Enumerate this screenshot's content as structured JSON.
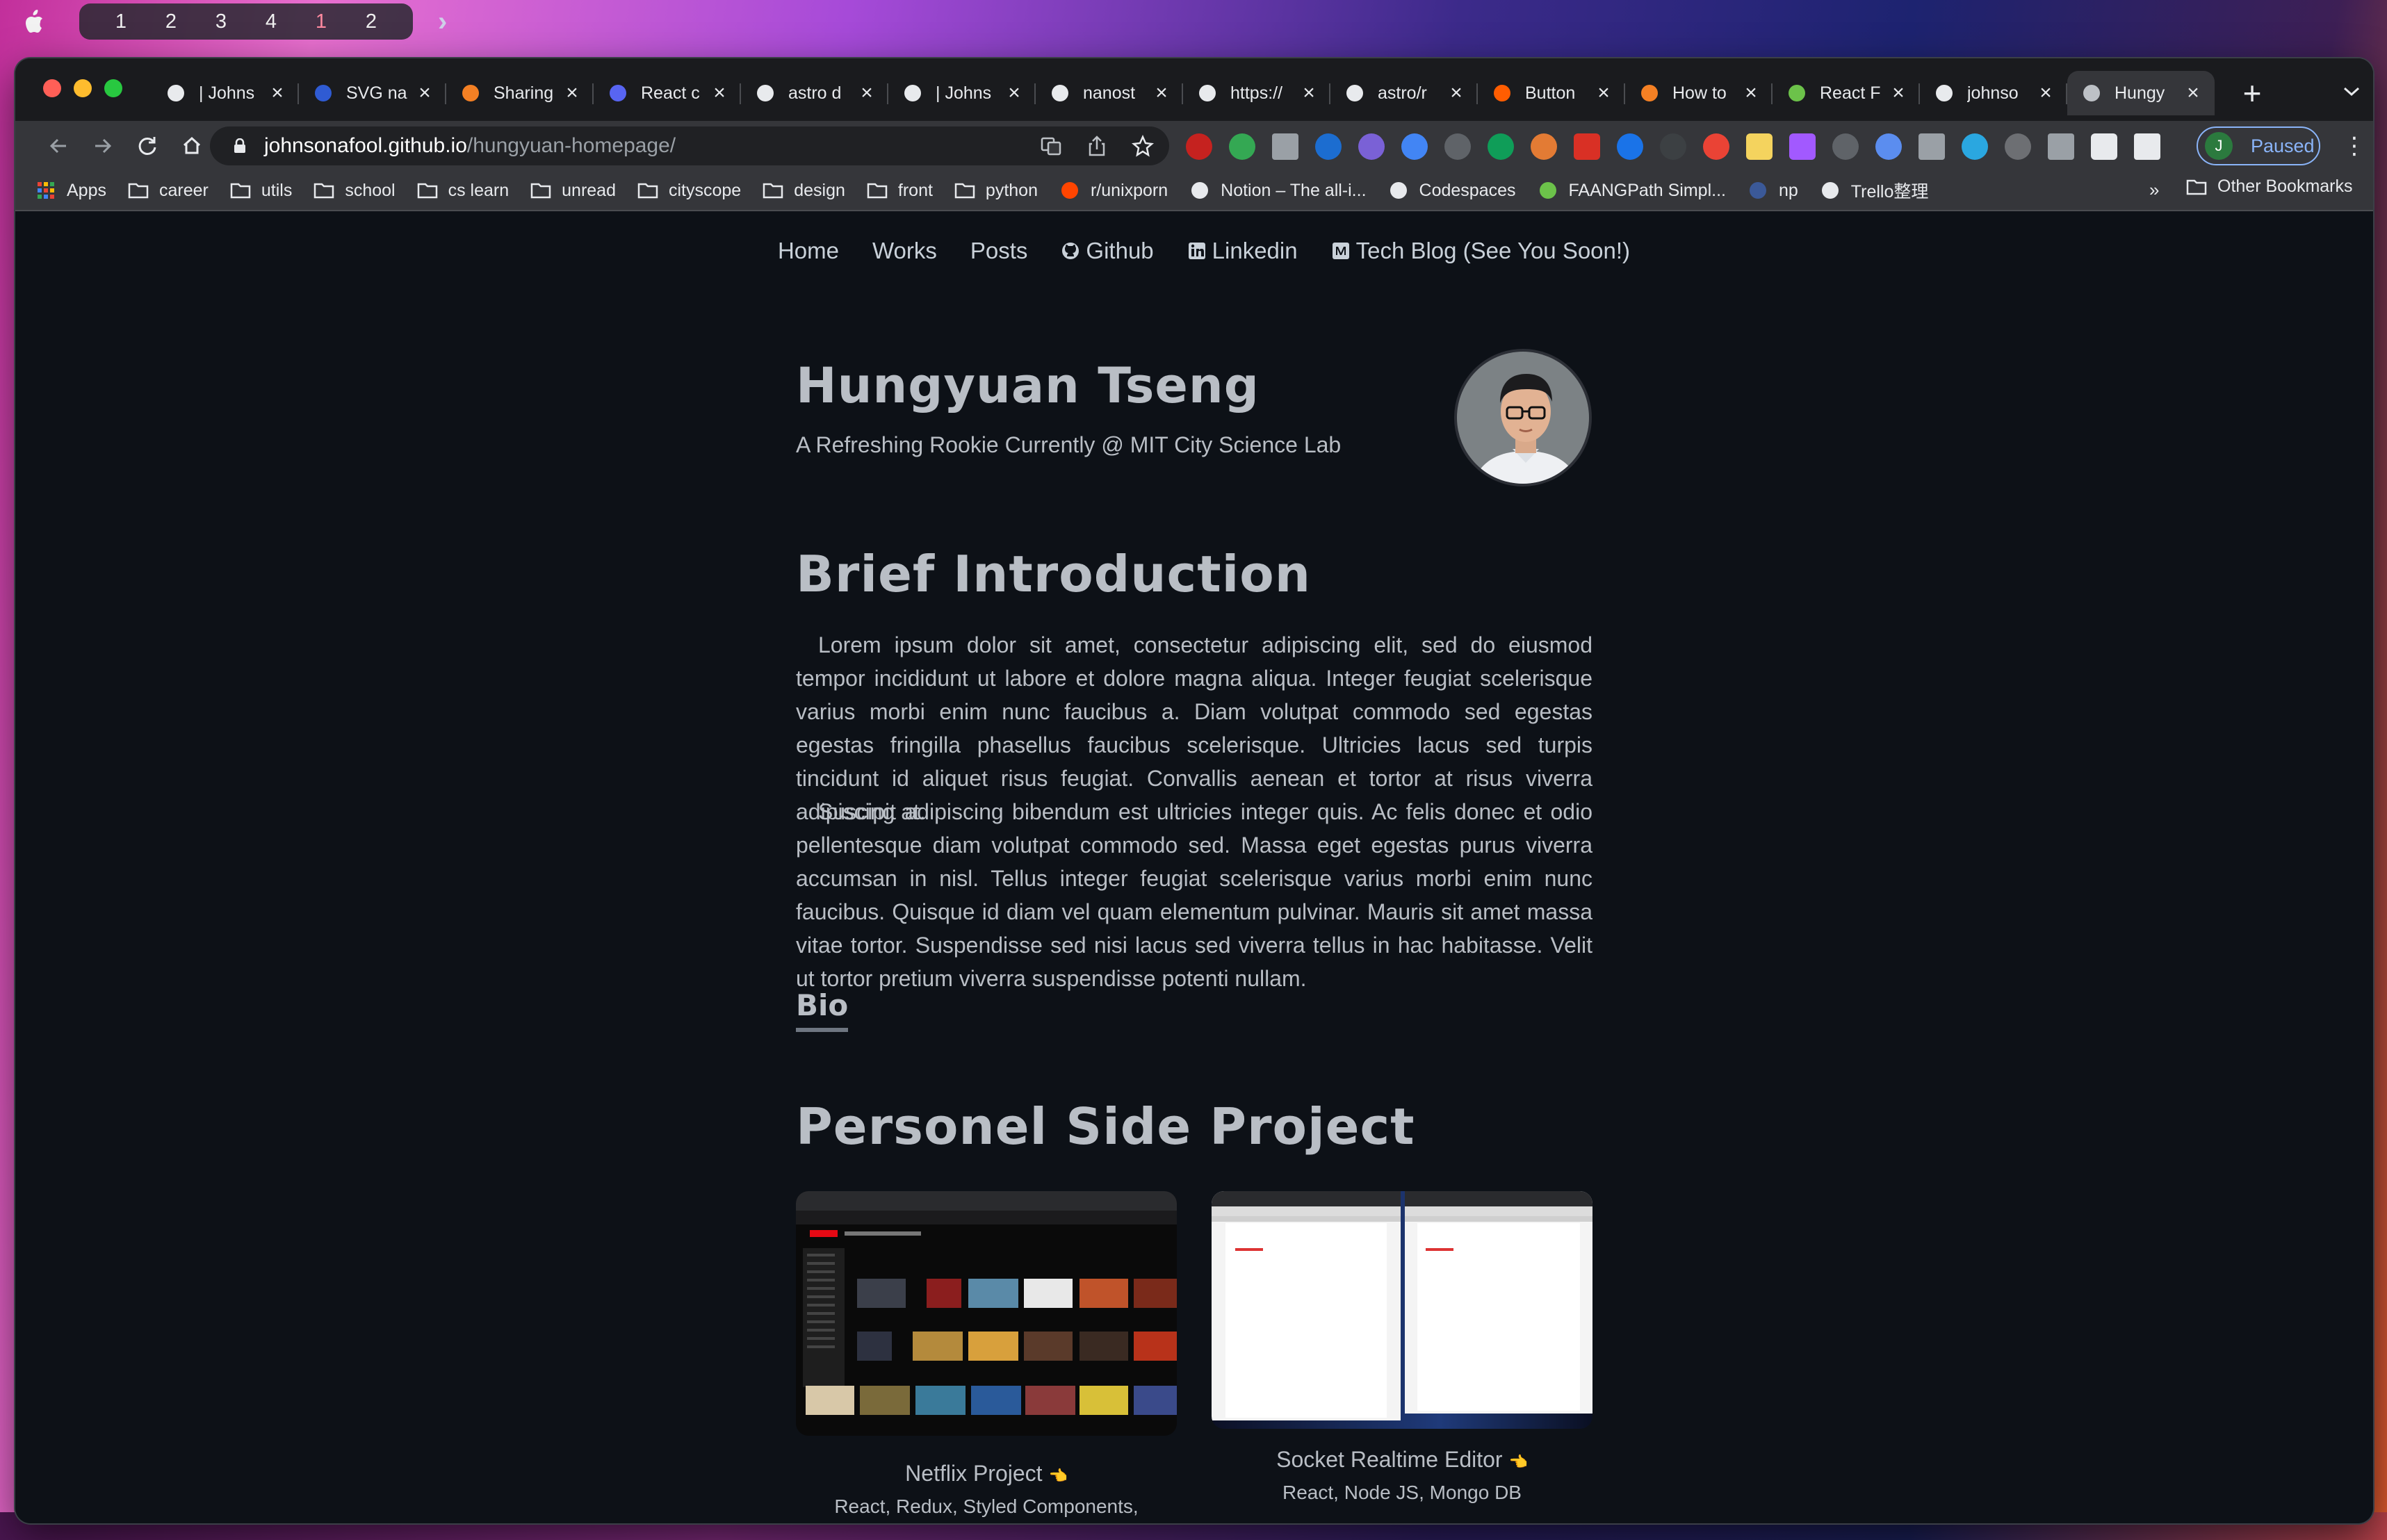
{
  "menubar": {
    "spaces": [
      "1",
      "2",
      "3",
      "4",
      "1",
      "2"
    ],
    "active_space": 4
  },
  "browser": {
    "tabs": [
      {
        "title": "| Johns",
        "icon": "astro-icon"
      },
      {
        "title": "SVG na",
        "icon": "w3-icon"
      },
      {
        "title": "Sharing",
        "icon": "stackoverflow-icon"
      },
      {
        "title": "React c",
        "icon": "mui-icon"
      },
      {
        "title": "astro d",
        "icon": "astro-docs-icon"
      },
      {
        "title": "| Johns",
        "icon": "astro-icon"
      },
      {
        "title": "nanost",
        "icon": "github-icon"
      },
      {
        "title": "https://",
        "icon": "amazon-icon"
      },
      {
        "title": "astro/r",
        "icon": "github-icon"
      },
      {
        "title": "Button",
        "icon": "astro-rocket-icon"
      },
      {
        "title": "How to",
        "icon": "stackoverflow-icon"
      },
      {
        "title": "React F",
        "icon": "react-code-icon"
      },
      {
        "title": "johnso",
        "icon": "github-icon"
      },
      {
        "title": "Hungy",
        "icon": "globe-icon"
      }
    ],
    "url_host": "johnsonafool.github.io",
    "url_path": "/hungyuan-homepage/",
    "profile_initial": "J",
    "profile_status": "Paused",
    "bookmarks": [
      {
        "label": "Apps",
        "icon": "apps-grid-icon"
      },
      {
        "label": "career",
        "icon": "folder-icon"
      },
      {
        "label": "utils",
        "icon": "folder-icon"
      },
      {
        "label": "school",
        "icon": "folder-icon"
      },
      {
        "label": "cs learn",
        "icon": "folder-icon"
      },
      {
        "label": "unread",
        "icon": "folder-icon"
      },
      {
        "label": "cityscope",
        "icon": "folder-icon"
      },
      {
        "label": "design",
        "icon": "folder-icon"
      },
      {
        "label": "front",
        "icon": "folder-icon"
      },
      {
        "label": "python",
        "icon": "folder-icon"
      },
      {
        "label": "r/unixporn",
        "icon": "reddit-icon"
      },
      {
        "label": "Notion – The all-i...",
        "icon": "notion-icon"
      },
      {
        "label": "Codespaces",
        "icon": "github-icon"
      },
      {
        "label": "FAANGPath Simpl...",
        "icon": "faangpath-icon"
      },
      {
        "label": "np",
        "icon": "np-icon"
      },
      {
        "label": "Trello整理",
        "icon": "trello-icon"
      }
    ],
    "bookmarks_overflow": "»",
    "other_bookmarks": "Other Bookmarks"
  },
  "site": {
    "nav": [
      {
        "label": "Home",
        "icon": ""
      },
      {
        "label": "Works",
        "icon": ""
      },
      {
        "label": "Posts",
        "icon": ""
      },
      {
        "label": "Github",
        "icon": "github-icon"
      },
      {
        "label": "Linkedin",
        "icon": "linkedin-icon"
      },
      {
        "label": "Tech Blog (See You Soon!)",
        "icon": "medium-icon"
      }
    ],
    "name": "Hungyuan Tseng",
    "tagline": "A Refreshing Rookie Currently @ MIT City Science Lab",
    "intro_heading": "Brief Introduction",
    "intro_p1": "Lorem ipsum dolor sit amet, consectetur adipiscing elit, sed do eiusmod tempor incididunt ut labore et dolore magna aliqua. Integer feugiat scelerisque varius morbi enim nunc faucibus a. Diam volutpat commodo sed egestas egestas fringilla phasellus faucibus scelerisque. Ultricies lacus sed turpis tincidunt id aliquet risus feugiat. Convallis aenean et tortor at risus viverra adipiscing at.",
    "intro_p2": "Suscipit adipiscing bibendum est ultricies integer quis. Ac felis donec et odio pellentesque diam volutpat commodo sed. Massa eget egestas purus viverra accumsan in nisl. Tellus integer feugiat scelerisque varius morbi enim nunc faucibus. Quisque id diam vel quam elementum pulvinar. Mauris sit amet massa vitae tortor. Suspendisse sed nisi lacus sed viverra tellus in hac habitasse. Velit ut tortor pretium viverra suspendisse potenti nullam.",
    "bio_heading": "Bio",
    "projects_heading": "Personel Side Project",
    "projects": [
      {
        "title": "Netflix Project",
        "title_icon": "👈",
        "desc": "React, Redux, Styled Components, FireBase"
      },
      {
        "title": "Socket Realtime Editor",
        "title_icon": "👈",
        "desc": "React, Node JS, Mongo DB"
      }
    ]
  },
  "colors": {
    "page_bg": "#0d1117",
    "text": "#b9bec5",
    "accent_blue": "#8ab4f8"
  }
}
